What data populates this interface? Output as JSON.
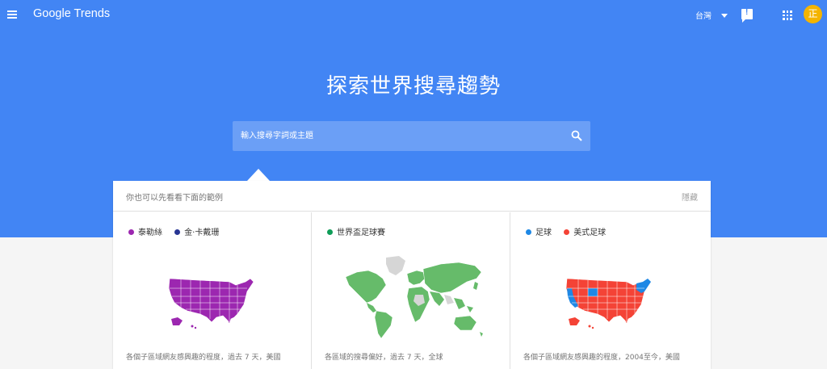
{
  "header": {
    "logo_google": "Google",
    "logo_trends": "Trends",
    "region": "台灣",
    "avatar_initial": "正"
  },
  "hero": {
    "headline": "探索世界搜尋趨勢",
    "search_placeholder": "輸入搜尋字詞或主題"
  },
  "examples": {
    "title": "你也可以先看看下面的範例",
    "hide_label": "隱藏",
    "cards": [
      {
        "legend": [
          {
            "label": "泰勒絲",
            "color": "#9c27b0"
          },
          {
            "label": "金·卡戴珊",
            "color": "#283593"
          }
        ],
        "caption": "各個子區域網友感興趣的程度，過去 7 天，美國"
      },
      {
        "legend": [
          {
            "label": "世界盃足球賽",
            "color": "#0f9d58"
          }
        ],
        "caption": "各區域的搜尋偏好，過去 7 天，全球"
      },
      {
        "legend": [
          {
            "label": "足球",
            "color": "#1e88e5"
          },
          {
            "label": "美式足球",
            "color": "#f44336"
          }
        ],
        "caption": "各個子區域網友感興趣的程度，2004至今，美國"
      }
    ]
  },
  "colors": {
    "hero_bg": "#4285f4",
    "avatar_bg": "#f4b400",
    "map_purple": "#9c27b0",
    "map_green": "#66bb6a",
    "map_red": "#f44336",
    "map_blue": "#1e88e5",
    "map_gray": "#d6d6d6"
  },
  "icons": {
    "menu": "hamburger-menu-icon",
    "region_caret": "caret-down-icon",
    "feedback": "feedback-icon",
    "apps": "apps-grid-icon",
    "search": "search-icon"
  }
}
